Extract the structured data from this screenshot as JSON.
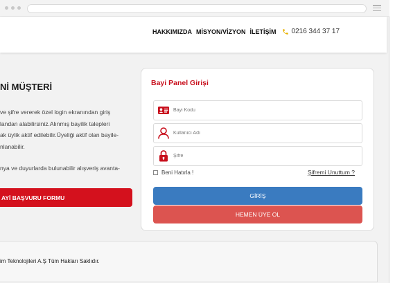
{
  "header": {
    "nav": [
      "HAKKIMIZDA",
      "MİSYON/VİZYON",
      "İLETİŞİM"
    ],
    "phone": "0216 344 37 17"
  },
  "left": {
    "title": "Nİ MÜŞTERİ",
    "lines": [
      "ve şifre vererek özel login ekranından giriş",
      "landan alabilirsiniz.Alınmış bayilik talepleri",
      "ak üylik aktif edilebilir.Üyeliği aktif olan bayile-",
      "nlanabilir."
    ],
    "line2": "nya ve duyurlarda bulunabilir alışveriş avanta-",
    "apply_button": "AYİ BAŞVURU FORMU"
  },
  "panel": {
    "title": "Bayi Panel Girişi",
    "dealer_code_placeholder": "Bayi Kodu",
    "username_placeholder": "Kullanıcı Adı",
    "password_placeholder": "Şifre",
    "remember_label": "Beni Hatırla !",
    "forgot_label": "Şifremi Unuttum ?",
    "login_button": "GİRİŞ",
    "register_button": "HEMEN ÜYE OL"
  },
  "footer": {
    "copyright": "im Teknolojileri A.Ş Tüm Hakları Saklıdır."
  },
  "colors": {
    "brand_red": "#d4111d",
    "login_blue": "#3a7bc0",
    "register_red": "#dc5450",
    "phone_icon": "#e8b200"
  },
  "icons": [
    "id-card-icon",
    "user-icon",
    "lock-icon",
    "phone-icon"
  ]
}
